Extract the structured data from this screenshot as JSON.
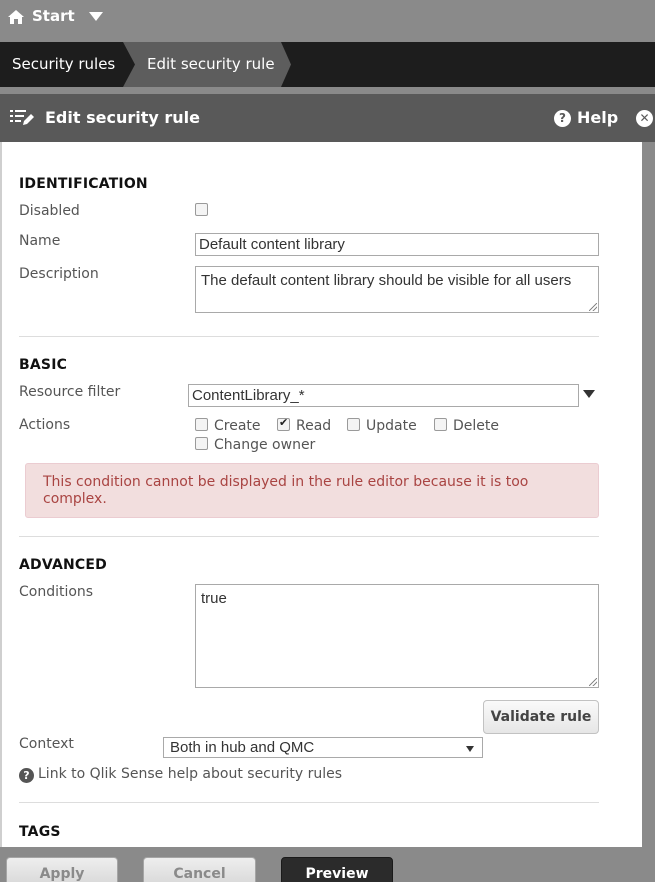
{
  "topbar": {
    "start_label": "Start"
  },
  "breadcrumbs": [
    "Security rules",
    "Edit security rule"
  ],
  "header": {
    "title": "Edit security rule",
    "help_label": "Help"
  },
  "identification": {
    "title": "IDENTIFICATION",
    "disabled_label": "Disabled",
    "disabled_checked": false,
    "name_label": "Name",
    "name_value": "Default content library",
    "description_label": "Description",
    "description_value": "The default content library should be visible for all users"
  },
  "basic": {
    "title": "BASIC",
    "resource_filter_label": "Resource filter",
    "resource_filter_value": "ContentLibrary_*",
    "actions_label": "Actions",
    "actions": [
      {
        "label": "Create",
        "checked": false
      },
      {
        "label": "Read",
        "checked": true
      },
      {
        "label": "Update",
        "checked": false
      },
      {
        "label": "Delete",
        "checked": false
      },
      {
        "label": "Change owner",
        "checked": false
      }
    ],
    "alert": "This condition cannot be displayed in the rule editor because it is too complex."
  },
  "advanced": {
    "title": "ADVANCED",
    "conditions_label": "Conditions",
    "conditions_value": "true",
    "validate_label": "Validate rule",
    "context_label": "Context",
    "context_value": "Both in hub and QMC",
    "help_link": "Link to Qlik Sense help about security rules"
  },
  "tags": {
    "title": "TAGS"
  },
  "footer": {
    "apply": "Apply",
    "cancel": "Cancel",
    "preview": "Preview"
  },
  "colors": {
    "alert_bg": "#f2dede",
    "alert_text": "#a94442",
    "header_bg": "#595959",
    "breadcrumb_bg": "#1d1d1d"
  }
}
